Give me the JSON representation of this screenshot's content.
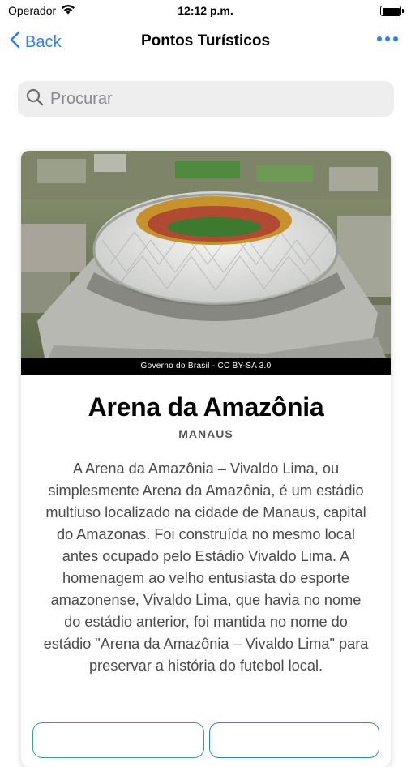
{
  "status_bar": {
    "carrier": "Operador",
    "time": "12:12 p.m."
  },
  "nav": {
    "back_label": "Back",
    "title": "Pontos Turísticos"
  },
  "search": {
    "placeholder": "Procurar",
    "value": ""
  },
  "card": {
    "image_credit": "Governo do Brasil - CC BY-SA 3.0",
    "title": "Arena da Amazônia",
    "subtitle": "MANAUS",
    "description": "A Arena da Amazônia – Vivaldo Lima, ou simplesmente Arena da Amazônia, é um estádio multiuso localizado na cidade de Manaus, capital do Amazonas. Foi construída no mesmo local antes ocupado pelo Estádio Vivaldo Lima. A homenagem ao velho entusiasta do esporte amazonense, Vivaldo Lima, que havia no nome do estádio anterior, foi mantida no nome do estádio \"Arena da Amazônia – Vivaldo Lima\" para preservar a história do futebol local."
  },
  "colors": {
    "accent": "#2f7cf6",
    "button_green": "#3aa57a",
    "search_bg": "#eeeeef"
  },
  "icons": {
    "back": "chevron-left-icon",
    "more": "ellipsis-icon",
    "search": "magnifier-icon",
    "wifi": "wifi-icon",
    "battery": "battery-icon"
  }
}
